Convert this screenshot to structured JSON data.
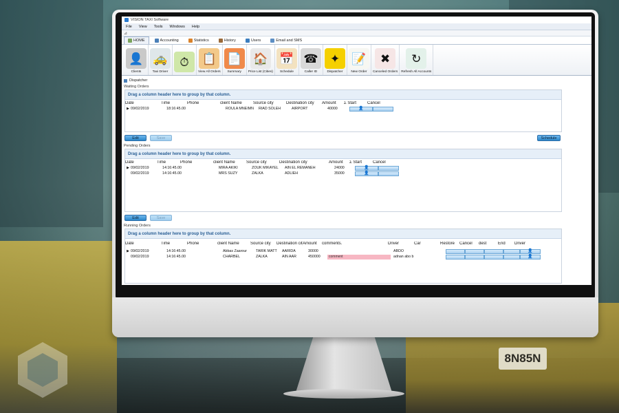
{
  "app": {
    "title": "VISION TAXI Software",
    "menu": [
      "File",
      "View",
      "Tools",
      "Windows",
      "Help"
    ]
  },
  "ribbon_tabs": [
    {
      "label": "HOME",
      "active": true,
      "color": "#7aa35b"
    },
    {
      "label": "Accounting",
      "active": false,
      "color": "#4a7fb8"
    },
    {
      "label": "Statistics",
      "active": false,
      "color": "#d9822b"
    },
    {
      "label": "History",
      "active": false,
      "color": "#9a6a3a"
    },
    {
      "label": "Users",
      "active": false,
      "color": "#3c7ebf"
    },
    {
      "label": "Email and SMS",
      "active": false,
      "color": "#5d8fc4"
    }
  ],
  "ribbon_buttons": [
    {
      "label": "Clients",
      "icon": "bust-statue-icon",
      "glyph": "👤",
      "bg": "#c9c9c9"
    },
    {
      "label": "Taxi Driver",
      "icon": "taxi-driver-icon",
      "glyph": "🚕",
      "bg": "#dfe7ea"
    },
    {
      "label": "",
      "icon": "clock-icon",
      "glyph": "⏱",
      "bg": "#cfe7a8"
    },
    {
      "label": "View All Orders",
      "icon": "clipboard-check-icon",
      "glyph": "📋",
      "bg": "#f3c98a"
    },
    {
      "label": "Summary",
      "icon": "summary-icon",
      "glyph": "📄",
      "bg": "#f08a4b"
    },
    {
      "label": "Price List (Cities)",
      "icon": "house-icon",
      "glyph": "🏠",
      "bg": "#e9e9e9"
    },
    {
      "label": "Schedule",
      "icon": "calendar-icon",
      "glyph": "📅",
      "bg": "#f3e2c0"
    },
    {
      "label": "Caller ID",
      "icon": "telephone-icon",
      "glyph": "☎",
      "bg": "#d8d8d8"
    },
    {
      "label": "Dispatcher",
      "icon": "dispatcher-icon",
      "glyph": "✦",
      "bg": "#f5d000"
    },
    {
      "label": "New Order",
      "icon": "new-order-icon",
      "glyph": "📝",
      "bg": "#f7f7f2"
    },
    {
      "label": "Canceled Orders",
      "icon": "red-x-icon",
      "glyph": "✖",
      "bg": "#f6e6e6"
    },
    {
      "label": "Refresh All Accounts",
      "icon": "refresh-icon",
      "glyph": "↻",
      "bg": "#e3f1ea"
    }
  ],
  "dispatcher_title": "Dispatcher",
  "group_hint": "Drag a column header here to group by that column.",
  "waiting": {
    "label": "Waiting Orders",
    "columns": [
      "Date",
      "Time",
      "Phone",
      "client Name",
      "Source city",
      "Destination city",
      "Amount",
      "Σ Start",
      "Cancel"
    ],
    "rows": [
      {
        "date": "09/02/2019",
        "time": "18:16:45.00",
        "phone": "",
        "client": "ROULA MNEIMN",
        "source": "RIAD SOLEH",
        "dest": "AIRPORT",
        "amount": "40000"
      }
    ],
    "edit_label": "Edit",
    "save_label": "Save",
    "schedule_label": "Schedule"
  },
  "pending": {
    "label": "Pending Orders",
    "columns": [
      "Date",
      "Time",
      "Phone",
      "client Name",
      "Source city",
      "Destination city",
      "Amount",
      "Σ Start",
      "Cancel"
    ],
    "rows": [
      {
        "date": "09/02/2019",
        "time": "14:16:45.00",
        "phone": "",
        "client": "MIRA AKIKI",
        "source": "ZOUK MIKAYEL",
        "dest": "AIN EL REMANEH",
        "amount": "24000"
      },
      {
        "date": "09/02/2019",
        "time": "14:16:45.00",
        "phone": "",
        "client": "MRS SUZY",
        "source": "ZALKA",
        "dest": "ADLIEH",
        "amount": "35000"
      }
    ],
    "edit_label": "Edit",
    "save_label": "Save"
  },
  "running": {
    "label": "Running Orders",
    "columns": [
      "Date",
      "Time",
      "Phone",
      "client Name",
      "Source city",
      "Destination city",
      "Amount",
      "comments.",
      "Driver",
      "Car",
      "Restore",
      "Cancel",
      "dest",
      "End",
      "Driver"
    ],
    "rows": [
      {
        "date": "09/02/2019",
        "time": "14:16:45.00",
        "phone": "",
        "client": "Abbas Zaarour",
        "source": "TARIK MATT",
        "dest": "AARIDA",
        "amount": "30000",
        "comment": "",
        "driver": "ABDO",
        "car": ""
      },
      {
        "date": "09/02/2019",
        "time": "14:16:45.00",
        "phone": "",
        "client": "CHARBEL",
        "source": "ZALKA",
        "dest": "AIN AAR",
        "amount": "450000",
        "comment": "comment",
        "driver": "adnan abo b",
        "car": ""
      }
    ]
  },
  "scene": {
    "plate": "8N85N"
  }
}
